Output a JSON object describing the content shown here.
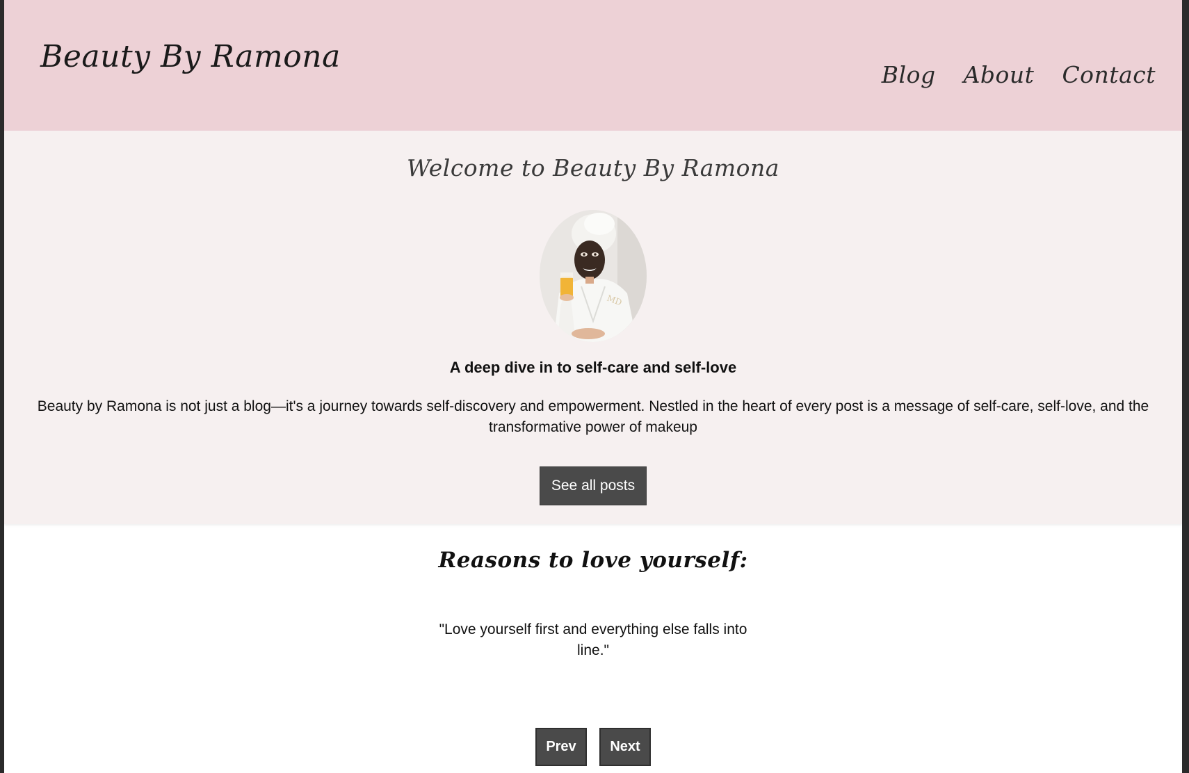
{
  "header": {
    "logo": "Beauty By Ramona",
    "nav": [
      "Blog",
      "About",
      "Contact"
    ]
  },
  "hero": {
    "title": "Welcome to Beauty By Ramona",
    "tagline": "A deep dive in to self-care and self-love",
    "intro": "Beauty by Ramona is not just a blog—it's a journey towards self-discovery and empowerment. Nestled in the heart of every post is a message of self-care, self-love, and the transformative power of makeup",
    "cta": "See all posts"
  },
  "reasons": {
    "title": "Reasons to love yourself:",
    "quote": "\"Love yourself first and everything else falls into line.\"",
    "prev_label": "Prev",
    "next_label": "Next"
  },
  "colors": {
    "header_bg": "#edd1d6",
    "hero_bg": "#f6f0f0",
    "button_bg": "#4a4a4a"
  }
}
